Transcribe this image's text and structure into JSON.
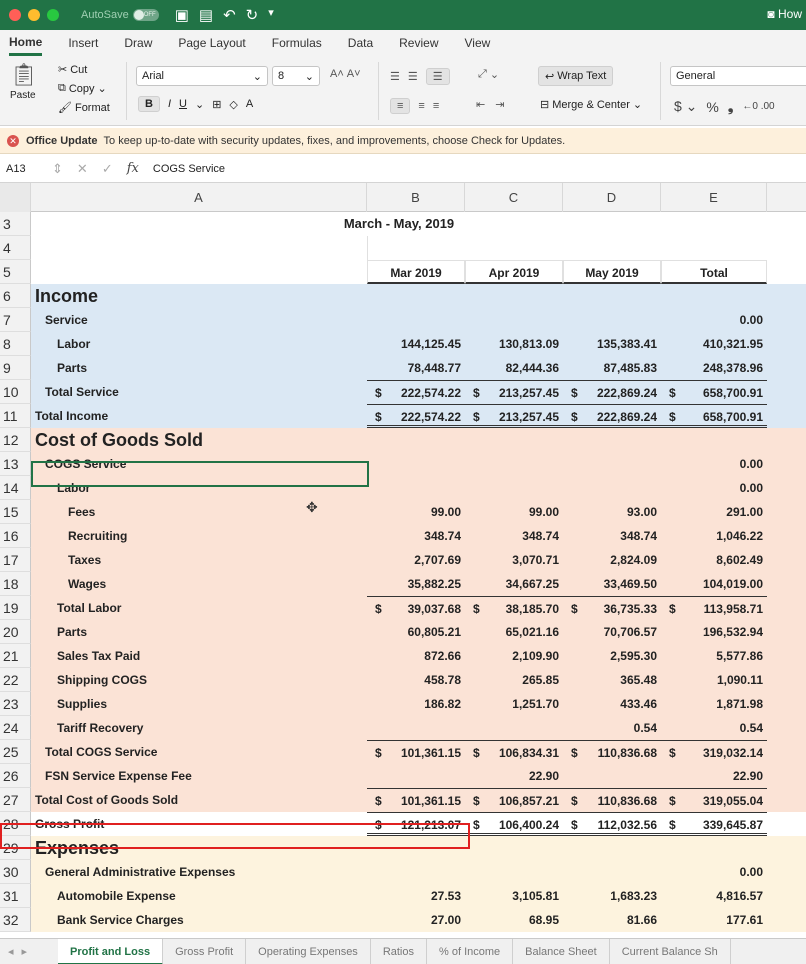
{
  "titlebar": {
    "autosave_label": "AutoSave",
    "autosave_state": "OFF",
    "right_label": "How"
  },
  "ribbon": {
    "tabs": [
      "Home",
      "Insert",
      "Draw",
      "Page Layout",
      "Formulas",
      "Data",
      "Review",
      "View"
    ],
    "active_tab": "Home",
    "clipboard": {
      "paste": "Paste",
      "cut": "Cut",
      "copy": "Copy",
      "format": "Format"
    },
    "font_name": "Arial",
    "font_size": "8",
    "wrap_text": "Wrap Text",
    "merge_center": "Merge & Center",
    "number_format": "General"
  },
  "update_bar": {
    "title": "Office Update",
    "message": "To keep up-to-date with security updates, fixes, and improvements, choose Check for Updates."
  },
  "formula_bar": {
    "cell_ref": "A13",
    "content": "COGS Service"
  },
  "columns": [
    "A",
    "B",
    "C",
    "D",
    "E"
  ],
  "sheet": {
    "period": "March - May, 2019",
    "headers": [
      "Mar 2019",
      "Apr 2019",
      "May 2019",
      "Total"
    ],
    "rows": [
      {
        "n": "6",
        "label": "Income"
      },
      {
        "n": "7",
        "label": "Service",
        "e": "0.00"
      },
      {
        "n": "8",
        "label": "Labor",
        "b": "144,125.45",
        "c": "130,813.09",
        "d": "135,383.41",
        "e": "410,321.95"
      },
      {
        "n": "9",
        "label": "Parts",
        "b": "78,448.77",
        "c": "82,444.36",
        "d": "87,485.83",
        "e": "248,378.96"
      },
      {
        "n": "10",
        "label": "Total Service",
        "b": "222,574.22",
        "c": "213,257.45",
        "d": "222,869.24",
        "e": "658,700.91",
        "cur": "$"
      },
      {
        "n": "11",
        "label": "Total Income",
        "b": "222,574.22",
        "c": "213,257.45",
        "d": "222,869.24",
        "e": "658,700.91",
        "cur": "$"
      },
      {
        "n": "12",
        "label": "Cost of Goods Sold"
      },
      {
        "n": "13",
        "label": "COGS Service",
        "e": "0.00"
      },
      {
        "n": "14",
        "label": "Labor",
        "e": "0.00"
      },
      {
        "n": "15",
        "label": "Fees",
        "b": "99.00",
        "c": "99.00",
        "d": "93.00",
        "e": "291.00"
      },
      {
        "n": "16",
        "label": "Recruiting",
        "b": "348.74",
        "c": "348.74",
        "d": "348.74",
        "e": "1,046.22"
      },
      {
        "n": "17",
        "label": "Taxes",
        "b": "2,707.69",
        "c": "3,070.71",
        "d": "2,824.09",
        "e": "8,602.49"
      },
      {
        "n": "18",
        "label": "Wages",
        "b": "35,882.25",
        "c": "34,667.25",
        "d": "33,469.50",
        "e": "104,019.00"
      },
      {
        "n": "19",
        "label": "Total Labor",
        "b": "39,037.68",
        "c": "38,185.70",
        "d": "36,735.33",
        "e": "113,958.71",
        "cur": "$"
      },
      {
        "n": "20",
        "label": "Parts",
        "b": "60,805.21",
        "c": "65,021.16",
        "d": "70,706.57",
        "e": "196,532.94"
      },
      {
        "n": "21",
        "label": "Sales Tax Paid",
        "b": "872.66",
        "c": "2,109.90",
        "d": "2,595.30",
        "e": "5,577.86"
      },
      {
        "n": "22",
        "label": "Shipping COGS",
        "b": "458.78",
        "c": "265.85",
        "d": "365.48",
        "e": "1,090.11"
      },
      {
        "n": "23",
        "label": "Supplies",
        "b": "186.82",
        "c": "1,251.70",
        "d": "433.46",
        "e": "1,871.98"
      },
      {
        "n": "24",
        "label": "Tariff Recovery",
        "d": "0.54",
        "e": "0.54"
      },
      {
        "n": "25",
        "label": "Total COGS Service",
        "b": "101,361.15",
        "c": "106,834.31",
        "d": "110,836.68",
        "e": "319,032.14",
        "cur": "$"
      },
      {
        "n": "26",
        "label": "FSN Service Expense Fee",
        "c": "22.90",
        "e": "22.90"
      },
      {
        "n": "27",
        "label": "Total Cost of Goods Sold",
        "b": "101,361.15",
        "c": "106,857.21",
        "d": "110,836.68",
        "e": "319,055.04",
        "cur": "$"
      },
      {
        "n": "28",
        "label": "Gross Profit",
        "b": "121,213.07",
        "c": "106,400.24",
        "d": "112,032.56",
        "e": "339,645.87",
        "cur": "$"
      },
      {
        "n": "29",
        "label": "Expenses"
      },
      {
        "n": "30",
        "label": "General Administrative Expenses",
        "e": "0.00"
      },
      {
        "n": "31",
        "label": "Automobile Expense",
        "b": "27.53",
        "c": "3,105.81",
        "d": "1,683.23",
        "e": "4,816.57"
      },
      {
        "n": "32",
        "label": "Bank Service Charges",
        "b": "27.00",
        "c": "68.95",
        "d": "81.66",
        "e": "177.61"
      }
    ]
  },
  "row_numbers_top": [
    "3",
    "4",
    "5"
  ],
  "sheet_tabs": [
    "Profit and Loss",
    "Gross Profit",
    "Operating Expenses",
    "Ratios",
    "% of Income",
    "Balance Sheet",
    "Current Balance Sh"
  ],
  "active_sheet": "Profit and Loss",
  "colors": {
    "excel_green": "#217346",
    "income_fill": "#dbe8f4",
    "cogs_fill": "#fbe3d6",
    "expense_fill": "#fdf3de",
    "highlight": "#e02020"
  }
}
